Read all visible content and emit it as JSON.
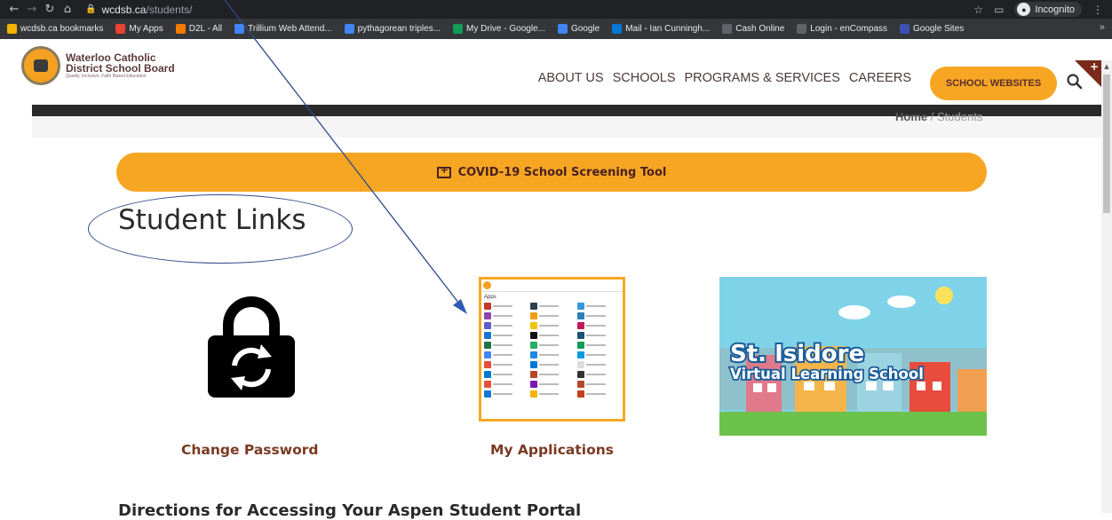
{
  "browser": {
    "url_host": "wcdsb.ca",
    "url_path": "/students/",
    "incognito_label": "Incognito",
    "bookmarks": [
      {
        "label": "wcdsb.ca bookmarks",
        "color": "#f4b400"
      },
      {
        "label": "My Apps",
        "color": "#e94235"
      },
      {
        "label": "D2L - All",
        "color": "#f57c00"
      },
      {
        "label": "Trillium Web Attend...",
        "color": "#4285f4"
      },
      {
        "label": "pythagorean triples...",
        "color": "#4285f4"
      },
      {
        "label": "My Drive - Google...",
        "color": "#0f9d58"
      },
      {
        "label": "Google",
        "color": "#4285f4"
      },
      {
        "label": "Mail - Ian Cunningh...",
        "color": "#0078d4"
      },
      {
        "label": "Cash Online",
        "color": "#5f6368"
      },
      {
        "label": "Login - enCompass",
        "color": "#5f6368"
      },
      {
        "label": "Google Sites",
        "color": "#3f51b5"
      }
    ],
    "more_bookmarks": "»"
  },
  "site": {
    "logo_title_line1": "Waterloo Catholic",
    "logo_title_line2": "District School Board",
    "logo_tagline": "Quality, Inclusive, Faith Based Education",
    "nav": [
      "ABOUT US",
      "SCHOOLS",
      "PROGRAMS & SERVICES",
      "CAREERS"
    ],
    "school_websites_label": "SCHOOL WEBSITES",
    "corner_plus": "+"
  },
  "breadcrumb": {
    "home": "Home",
    "separator": "/",
    "current": "Students"
  },
  "covid_label": "COVID-19 School Screening Tool",
  "page_title": "Student Links",
  "tiles": [
    {
      "label": "Change Password"
    },
    {
      "label": "My Applications"
    }
  ],
  "isidore": {
    "line1": "St. Isidore",
    "line2": "Virtual Learning School"
  },
  "apps_thumb": {
    "apps_word": "Apps",
    "colors": [
      "#c0392b",
      "#2c3e50",
      "#3498db",
      "#8e44ad",
      "#f39c12",
      "#2980b9",
      "#5b5fc7",
      "#f1c40f",
      "#c2185b",
      "#1976d2",
      "#111",
      "#1a5276",
      "#217346",
      "#27ae60",
      "#0f9d58",
      "#4285f4",
      "#1e88e5",
      "#039be5",
      "#e74c3c",
      "#0078d4",
      "#ddd",
      "#0078d4",
      "#b7472a",
      "#333",
      "#e84c3d",
      "#7719aa",
      "#b7472a",
      "#1976d2",
      "#f4b400",
      "#c43e1c"
    ]
  },
  "directions_heading": "Directions for Accessing Your Aspen Student Portal"
}
